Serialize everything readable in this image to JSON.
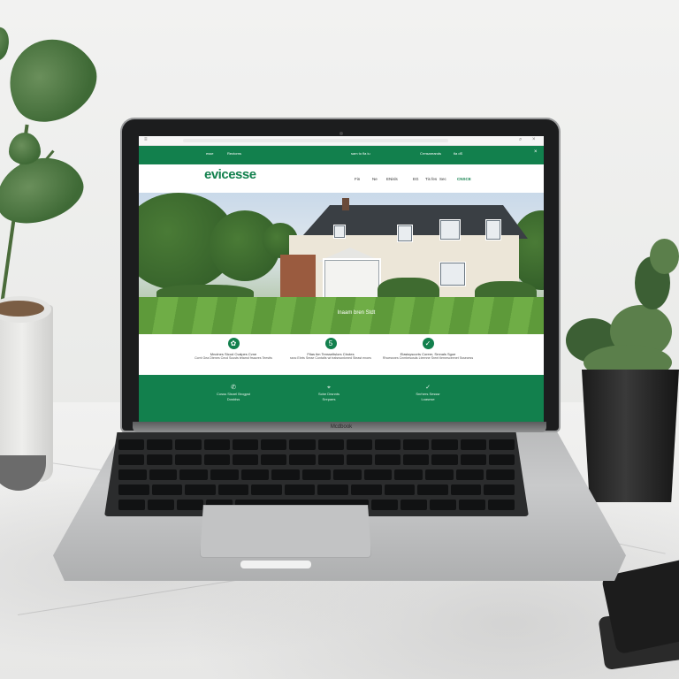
{
  "scene": {
    "description_items": [
      "laptop",
      "potted-plant-left",
      "potted-plant-right",
      "phone"
    ]
  },
  "laptop": {
    "brand_text": "Mcdbook"
  },
  "website": {
    "colors": {
      "brand": "#12804d",
      "white": "#ffffff"
    },
    "top_links": [
      "esse",
      "Rectorns",
      "sam to fla iu",
      "Crmsareands",
      "tla dS"
    ],
    "logo": "evicesse",
    "logo_tagline": "",
    "nav": [
      "Fin",
      "Ne",
      "ENisls",
      "EG",
      "Tis fes",
      "Sec",
      "CNSCE"
    ],
    "hero_caption": "Inaam bren Stdt",
    "features": [
      {
        "icon": "leaf-icon",
        "title": "Mnolnes Stcod Cvalpes Cvne",
        "text": "Ccmt Gea Dtenes Cecd Scusts tetamd frsacres Teestts"
      },
      {
        "icon": "number-icon",
        "title": "Ftlas tim Tensseltslors Ctrotes",
        "text": "ssnc Ebrts Sreae Contalts wt tratsrsonkmed Steast enoes"
      },
      {
        "icon": "check-icon",
        "title": "Elasisyscorts Coreer, Srnnals Sgoe",
        "text": "Rhcessnes Cnmbesosds Lteenne Srent tlernesceenet Sssecess"
      }
    ],
    "footer": [
      {
        "icon": "phone-icon",
        "line1": "Cosss Slsnel Brogpst",
        "line2": "Dostdss"
      },
      {
        "icon": "pin-icon",
        "line1": "Scbe Drsnnts",
        "line2": "Srepaes"
      },
      {
        "icon": "check-icon",
        "line1": "Snrhers Sesssr",
        "line2": "Loasnse"
      }
    ]
  }
}
